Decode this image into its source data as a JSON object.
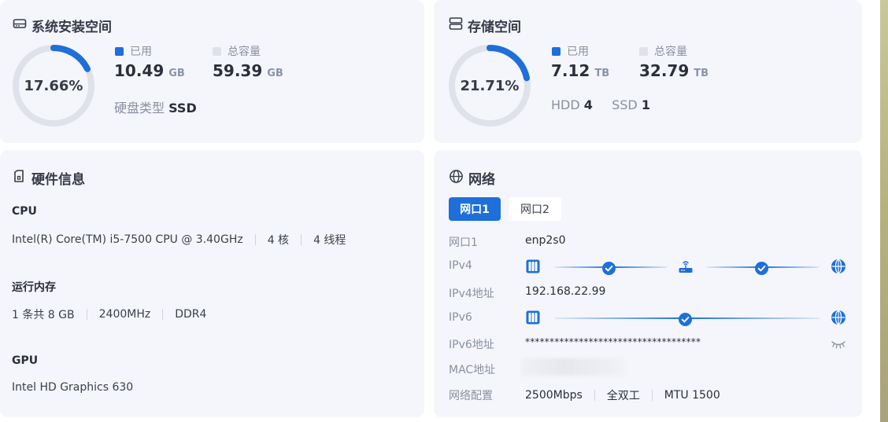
{
  "system_storage": {
    "title": "系统安装空间",
    "icon": "hard-drive-icon",
    "percent_label": "17.66%",
    "percent": 17.66,
    "used_label": "已用",
    "used_value": "10.49",
    "used_unit": "GB",
    "total_label": "总容量",
    "total_value": "59.39",
    "total_unit": "GB",
    "disk_type_label": "硬盘类型",
    "disk_type_value": "SSD"
  },
  "storage": {
    "title": "存储空间",
    "icon": "storage-icon",
    "percent_label": "21.71%",
    "percent": 21.71,
    "used_label": "已用",
    "used_value": "7.12",
    "used_unit": "TB",
    "total_label": "总容量",
    "total_value": "32.79",
    "total_unit": "TB",
    "hdd_label": "HDD",
    "hdd_count": "4",
    "ssd_label": "SSD",
    "ssd_count": "1"
  },
  "hardware": {
    "title": "硬件信息",
    "icon": "hardware-icon",
    "cpu_label": "CPU",
    "cpu_model": "Intel(R) Core(TM) i5-7500 CPU @ 3.40GHz",
    "cpu_cores": "4 核",
    "cpu_threads": "4 线程",
    "memory_label": "运行内存",
    "memory_sticks": "1 条共 8 GB",
    "memory_speed": "2400MHz",
    "memory_type": "DDR4",
    "gpu_label": "GPU",
    "gpu_model": "Intel HD Graphics 630"
  },
  "network": {
    "title": "网络",
    "icon": "globe-icon",
    "tabs": [
      {
        "label": "网口1",
        "active": true
      },
      {
        "label": "网口2",
        "active": false
      }
    ],
    "port_label": "网口1",
    "port_value": "enp2s0",
    "ipv4_label": "IPv4",
    "ipv4_addr_label": "IPv4地址",
    "ipv4_addr_value": "192.168.22.99",
    "ipv6_label": "IPv6",
    "ipv6_addr_label": "IPv6地址",
    "ipv6_addr_value": "************************************",
    "mac_label": "MAC地址",
    "config_label": "网络配置",
    "config_speed": "2500Mbps",
    "config_duplex": "全双工",
    "config_mtu": "MTU 1500"
  },
  "colors": {
    "accent": "#1e6fd9",
    "ring_track": "#dfe2ea",
    "card_bg": "#f4f6fb",
    "muted_text": "#8a90a0"
  }
}
